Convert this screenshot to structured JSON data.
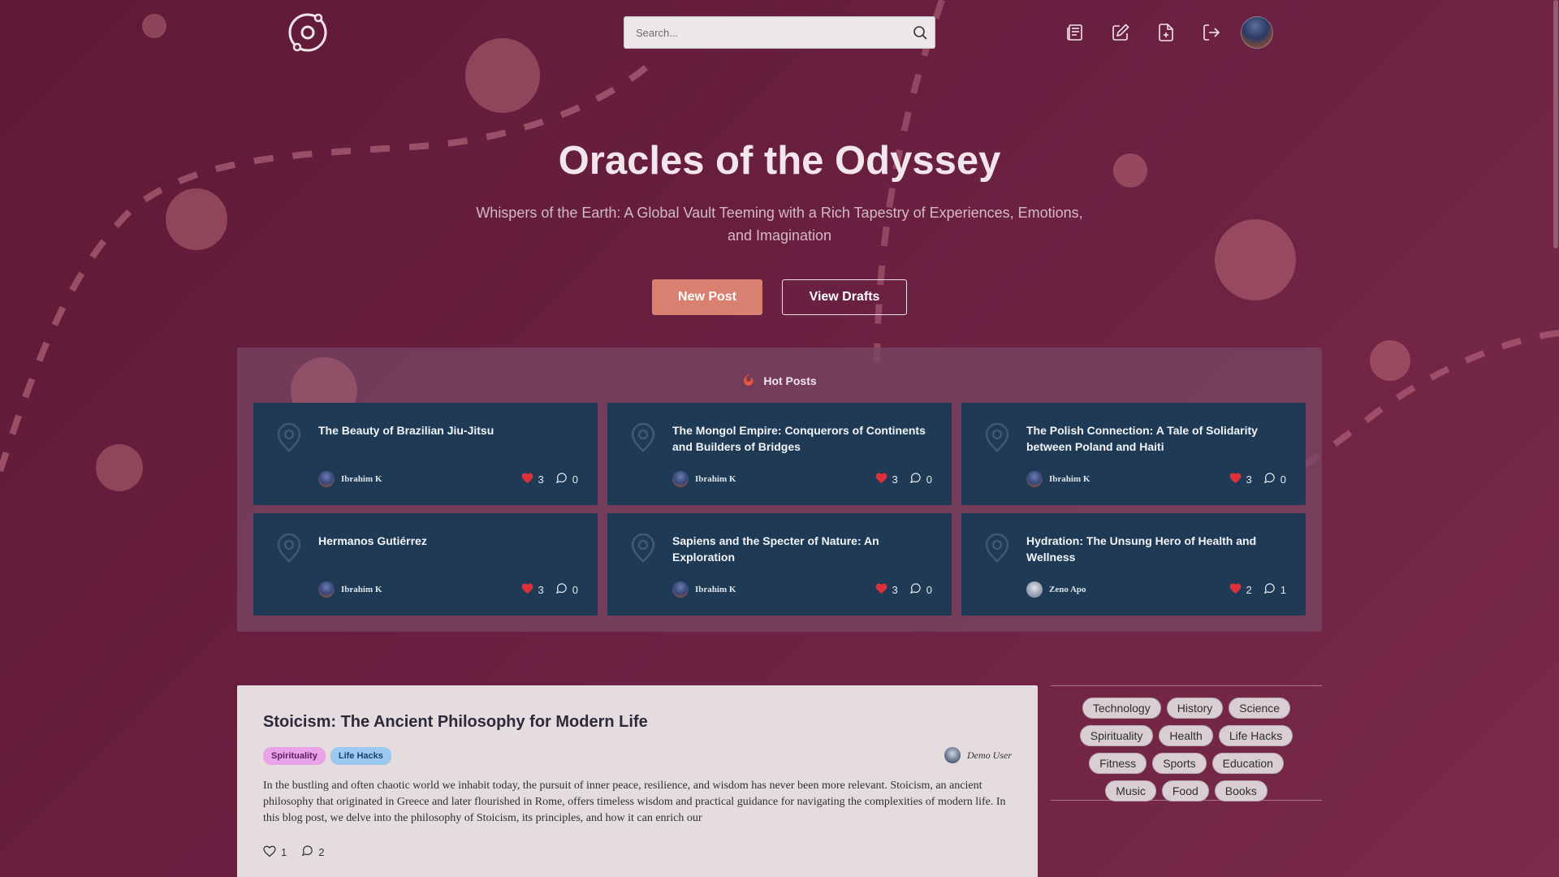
{
  "header": {
    "logo_icon": "orbit-logo-icon",
    "search_placeholder": "Search...",
    "nav": [
      {
        "icon": "articles-icon",
        "label": "Articles"
      },
      {
        "icon": "edit-icon",
        "label": "Write"
      },
      {
        "icon": "new-file-icon",
        "label": "New file"
      },
      {
        "icon": "logout-icon",
        "label": "Logout"
      }
    ]
  },
  "hero": {
    "title": "Oracles of the Odyssey",
    "subtitle": "Whispers of the Earth: A Global Vault Teeming with a Rich Tapestry of Experiences, Emotions, and Imagination",
    "new_post_label": "New Post",
    "view_drafts_label": "View Drafts"
  },
  "hot_posts": {
    "heading": "Hot Posts",
    "cards": [
      {
        "title": "The Beauty of Brazilian Jiu-Jitsu",
        "author": "Ibrahim K",
        "likes": "3",
        "comments": "0"
      },
      {
        "title": "The Mongol Empire: Conquerors of Continents and Builders of Bridges",
        "author": "Ibrahim K",
        "likes": "3",
        "comments": "0"
      },
      {
        "title": "The Polish Connection: A Tale of Solidarity between Poland and Haiti",
        "author": "Ibrahim K",
        "likes": "3",
        "comments": "0"
      },
      {
        "title": "Hermanos Gutiérrez",
        "author": "Ibrahim K",
        "likes": "3",
        "comments": "0"
      },
      {
        "title": "Sapiens and the Specter of Nature: An Exploration",
        "author": "Ibrahim K",
        "likes": "3",
        "comments": "0"
      },
      {
        "title": "Hydration: The Unsung Hero of Health and Wellness",
        "author": "Zeno Apo",
        "likes": "2",
        "comments": "1"
      }
    ]
  },
  "post": {
    "title": "Stoicism: The Ancient Philosophy for Modern Life",
    "tags": [
      "Spirituality",
      "Life Hacks"
    ],
    "author": "Demo User",
    "body": "In the bustling and often chaotic world we inhabit today, the pursuit of inner peace, resilience, and wisdom has never been more relevant. Stoicism, an ancient philosophy that originated in Greece and later flourished in Rome, offers timeless wisdom and practical guidance for navigating the complexities of modern life. In this blog post, we delve into the philosophy of Stoicism, its principles, and how it can enrich our",
    "likes": "1",
    "comments": "2"
  },
  "sidebar": {
    "tags": [
      "Technology",
      "History",
      "Science",
      "Spirituality",
      "Health",
      "Life Hacks",
      "Fitness",
      "Sports",
      "Education",
      "Music",
      "Food",
      "Books"
    ]
  },
  "colors": {
    "background": "#6a2040",
    "accent_button": "#d98070",
    "card": "#1e3a55",
    "heart": "#e0303a"
  }
}
